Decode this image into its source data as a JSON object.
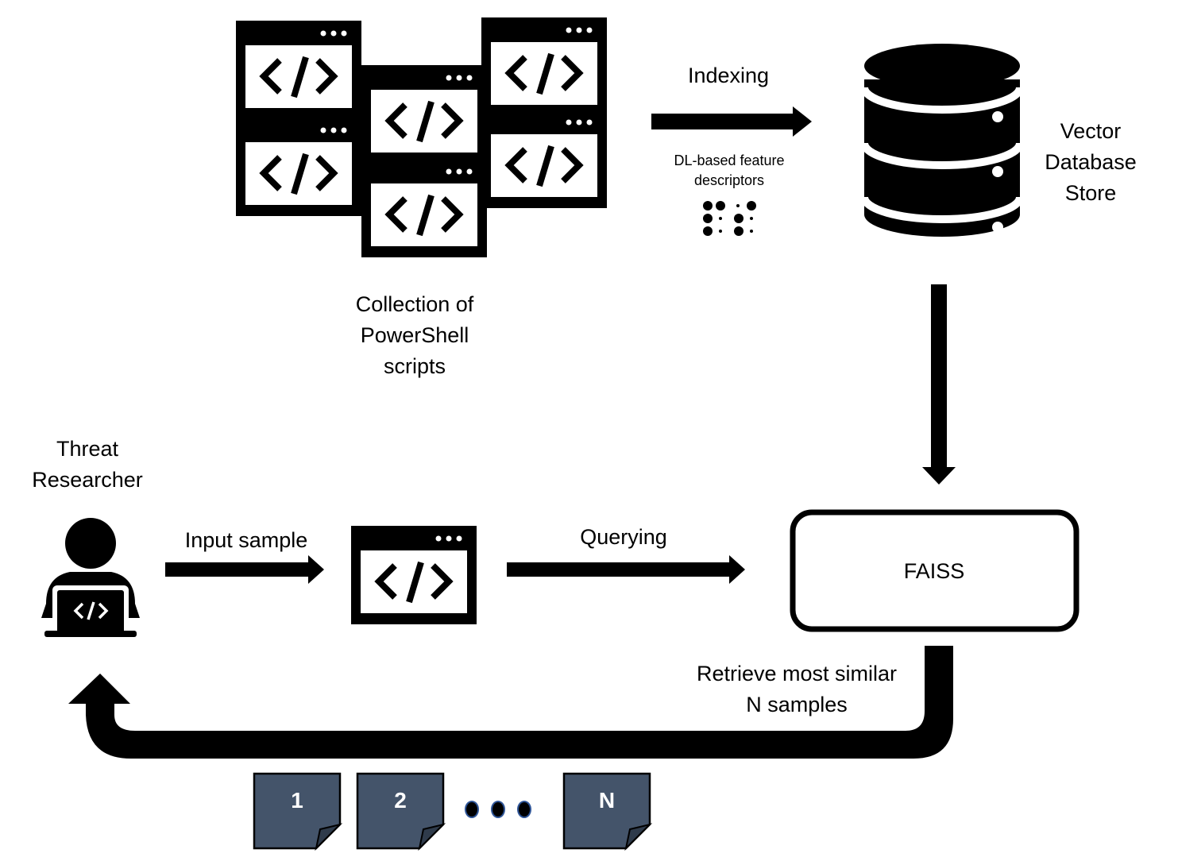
{
  "diagram": {
    "collection_label": "Collection of PowerShell scripts",
    "collection_lines": [
      "Collection of",
      "PowerShell",
      "scripts"
    ],
    "indexing_label": "Indexing",
    "descriptor_lines": [
      "DL-based feature",
      "descriptors"
    ],
    "database_lines": [
      "Vector",
      "Database",
      "Store"
    ],
    "researcher_lines": [
      "Threat",
      "Researcher"
    ],
    "input_label": "Input sample",
    "querying_label": "Querying",
    "faiss_label": "FAISS",
    "retrieve_lines": [
      "Retrieve most similar",
      "N samples"
    ],
    "results": [
      "1",
      "2",
      "N"
    ],
    "ellipsis_count": 3,
    "script_window_count": 6,
    "colors": {
      "ink": "#000000",
      "result_doc": "#44546a",
      "ellipsis_stroke": "#2f5597"
    },
    "icons": {
      "script": "code-window-icon",
      "database": "database-icon",
      "researcher": "researcher-laptop-icon",
      "descriptor": "braille-dots-icon",
      "result": "document-icon"
    }
  }
}
